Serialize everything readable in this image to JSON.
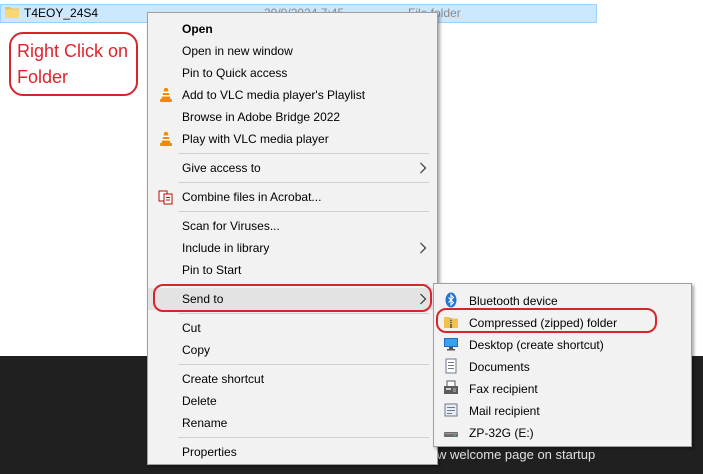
{
  "explorer": {
    "folder_name": "T4EOY_24S4",
    "date_modified": "30/9/2024 7:45",
    "item_type": "File folder"
  },
  "annotation": {
    "line1": "Right Click on",
    "line2": "Folder",
    "color": "#e0232b"
  },
  "background_text": "w welcome page on startup",
  "context_menu": {
    "open": "Open",
    "open_new_window": "Open in new window",
    "pin_quick_access": "Pin to Quick access",
    "vlc_playlist": "Add to VLC media player's Playlist",
    "adobe_bridge": "Browse in Adobe Bridge 2022",
    "vlc_play": "Play with VLC media player",
    "give_access": "Give access to",
    "acrobat_combine": "Combine files in Acrobat...",
    "scan_viruses": "Scan for Viruses...",
    "include_library": "Include in library",
    "pin_start": "Pin to Start",
    "send_to": "Send to",
    "cut": "Cut",
    "copy": "Copy",
    "create_shortcut": "Create shortcut",
    "delete": "Delete",
    "rename": "Rename",
    "properties": "Properties"
  },
  "send_to_menu": {
    "bluetooth": "Bluetooth device",
    "compressed": "Compressed (zipped) folder",
    "desktop": "Desktop (create shortcut)",
    "documents": "Documents",
    "fax": "Fax recipient",
    "mail": "Mail recipient",
    "drive": "ZP-32G (E:)"
  },
  "icons": {
    "folder": "folder-icon",
    "vlc": "vlc-cone-icon",
    "acrobat": "acrobat-combine-icon",
    "submenu_arrow": "chevron-right-icon",
    "bluetooth": "bluetooth-icon",
    "zip": "zip-folder-icon",
    "desktop": "desktop-icon",
    "documents": "documents-icon",
    "fax": "fax-icon",
    "mail": "mail-icon",
    "drive": "usb-drive-icon"
  },
  "colors": {
    "highlight_red": "#d7262b",
    "selection_blue": "#cce8ff",
    "menu_bg": "#f2f2f2"
  }
}
